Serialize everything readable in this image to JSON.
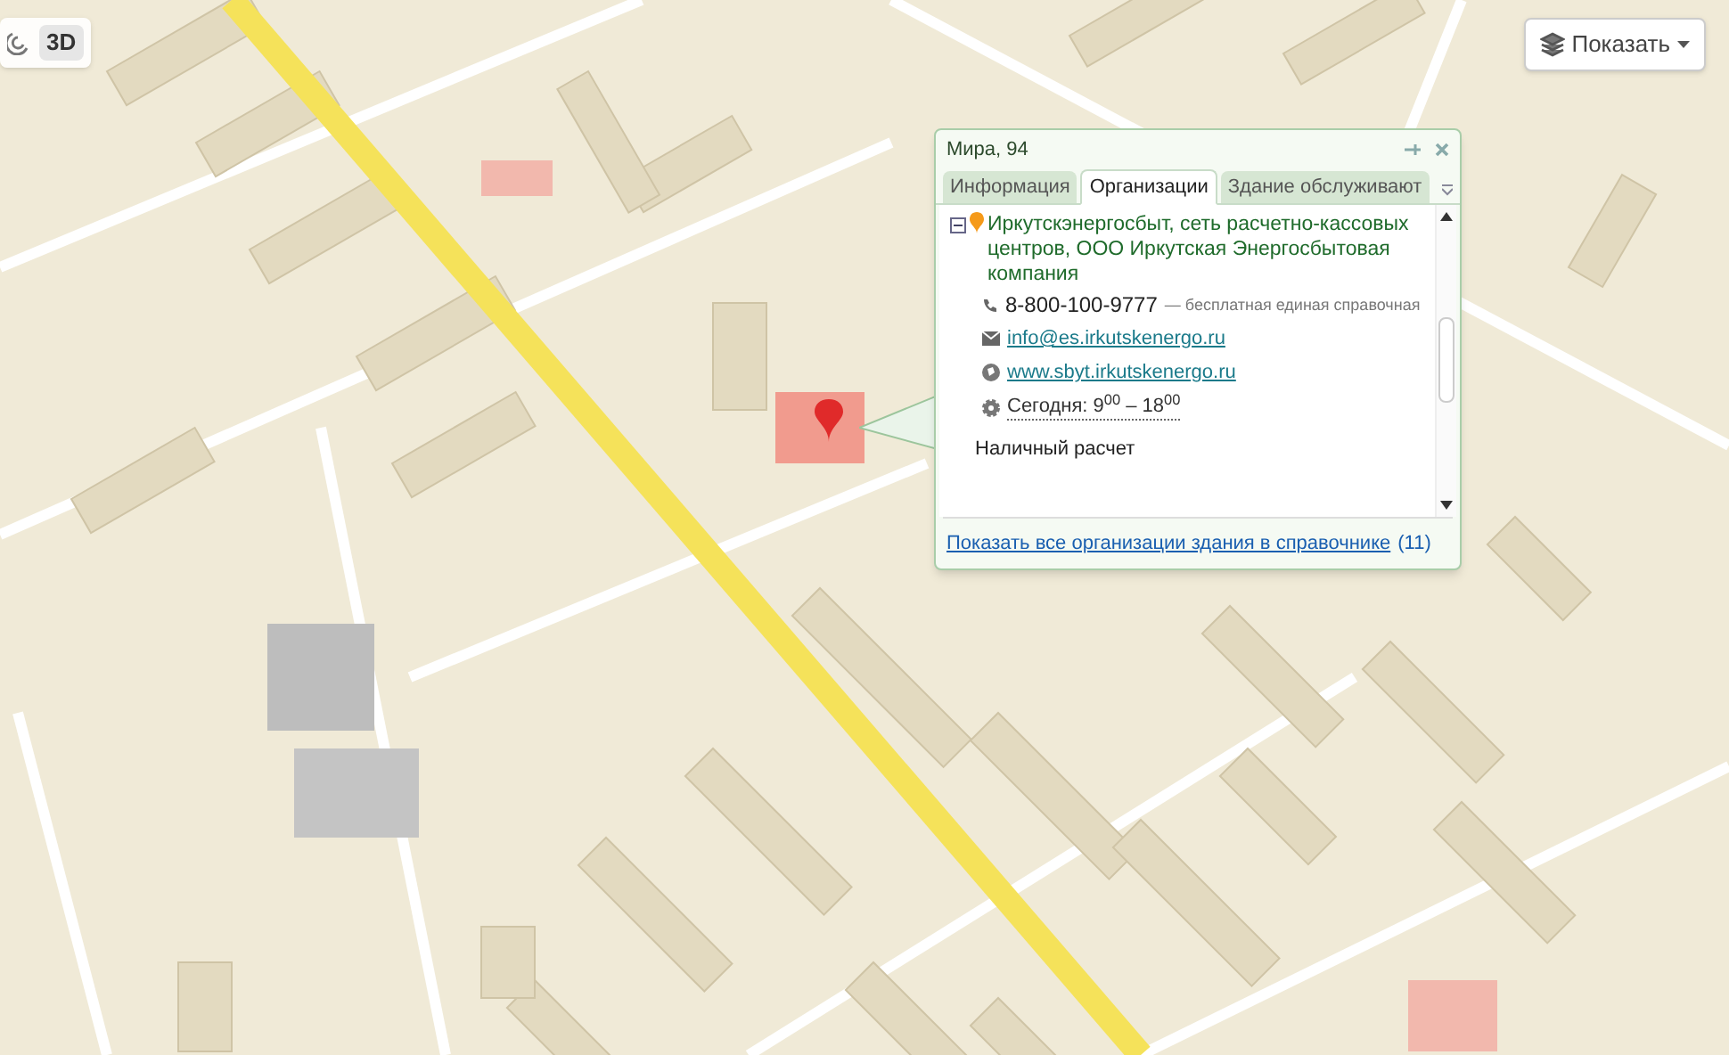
{
  "map_controls": {
    "mode_button": "3D",
    "layers_button": "Показать"
  },
  "popup": {
    "title": "Мира, 94",
    "tabs": [
      {
        "label": "Информация",
        "selected": false
      },
      {
        "label": "Организации",
        "selected": true
      },
      {
        "label": "Здание обслуживают",
        "selected": false
      }
    ],
    "organization": {
      "expanded": true,
      "name": "Иркутскэнергосбыт, сеть расчетно-кассовых центров, ООО Иркутская Энергосбытовая компания",
      "phone": "8-800-100-9777",
      "phone_note": "— бесплатная единая справочная",
      "email": "info@es.irkutskenergo.ru",
      "website": "www.sbyt.irkutskenergo.ru",
      "hours": "Сегодня: 9$^{00}$ – 18$^{00}$",
      "payment": "Наличный расчет"
    },
    "footer_link": "Показать все организации здания в справочнике",
    "footer_count": "(11)"
  }
}
